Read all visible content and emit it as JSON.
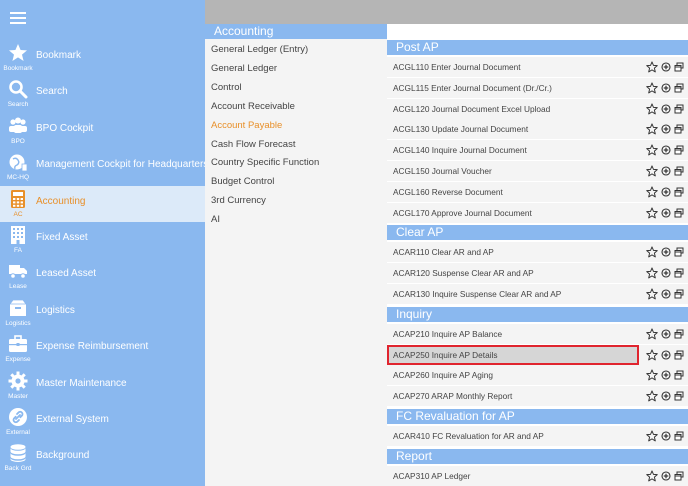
{
  "sidebar": {
    "items": [
      {
        "icon": "star-icon",
        "caption": "Bookmark",
        "label": "Bookmark",
        "active": false
      },
      {
        "icon": "search-icon",
        "caption": "Search",
        "label": "Search",
        "active": false
      },
      {
        "icon": "people-icon",
        "caption": "BPO",
        "label": "BPO Cockpit",
        "active": false
      },
      {
        "icon": "globe-icon",
        "caption": "MC-HQ",
        "label": "Management Cockpit for Headquarters",
        "active": false
      },
      {
        "icon": "calculator-icon",
        "caption": "AC",
        "label": "Accounting",
        "active": true
      },
      {
        "icon": "building-icon",
        "caption": "FA",
        "label": "Fixed Asset",
        "active": false
      },
      {
        "icon": "truck-icon",
        "caption": "Lease",
        "label": "Leased Asset",
        "active": false
      },
      {
        "icon": "box-icon",
        "caption": "Logistics",
        "label": "Logistics",
        "active": false
      },
      {
        "icon": "briefcase-icon",
        "caption": "Expense",
        "label": "Expense Reimbursement",
        "active": false
      },
      {
        "icon": "gear-icon",
        "caption": "Master",
        "label": "Master Maintenance",
        "active": false
      },
      {
        "icon": "link-icon",
        "caption": "External",
        "label": "External System",
        "active": false
      },
      {
        "icon": "database-icon",
        "caption": "Back Grd",
        "label": "Background",
        "active": false
      }
    ]
  },
  "middle": {
    "title": "Accounting",
    "items": [
      "General Ledger (Entry)",
      "General Ledger",
      "Control",
      "Account Receivable",
      "Account Payable",
      "Cash Flow Forecast",
      "Country Specific Function",
      "Budget Control",
      "3rd Currency",
      "AI"
    ],
    "active_item": "Account Payable"
  },
  "right": {
    "sections": [
      {
        "title": "Post AP",
        "rows": [
          "ACGL110 Enter Journal Document",
          "ACGL115 Enter Journal Document (Dr./Cr.)",
          "ACGL120 Journal Document Excel Upload",
          "ACGL130 Update Journal Document",
          "ACGL140 Inquire Journal Document",
          "ACGL150 Journal Voucher",
          "ACGL160 Reverse Document",
          "ACGL170 Approve Journal Document"
        ]
      },
      {
        "title": "Clear AP",
        "rows": [
          "ACAR110 Clear AR and AP",
          "ACAR120 Suspense Clear AR and AP",
          "ACAR130 Inquire Suspense Clear AR and AP"
        ]
      },
      {
        "title": "Inquiry",
        "rows": [
          "ACAP210 Inquire AP Balance",
          "ACAP250 Inquire AP Details",
          "ACAP260 Inquire AP Aging",
          "ACAP270 ARAP Monthly Report"
        ]
      },
      {
        "title": "FC Revaluation for AP",
        "rows": [
          "ACAR410 FC Revaluation for AR and AP"
        ]
      },
      {
        "title": "Report",
        "rows": [
          "ACAP310 AP Ledger"
        ]
      }
    ],
    "selected_row": "ACAP250 Inquire AP Details"
  },
  "colors": {
    "sidebar_bg": "#8ab8ef",
    "accent_orange": "#e8902a",
    "selection_border": "#e0242e",
    "top_strip": "#b5b5b5"
  }
}
